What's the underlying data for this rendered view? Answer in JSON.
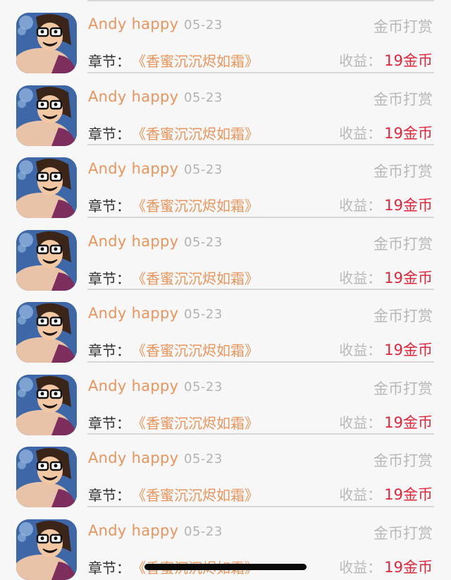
{
  "list": {
    "items": [
      {
        "name": "Andy happy",
        "date": "05-23",
        "type": "金币打赏",
        "chapter_label": "章节：",
        "chapter_name": "《香蜜沉沉烬如霜》",
        "earn_label": "收益：",
        "earn_value": "19金币"
      },
      {
        "name": "Andy happy",
        "date": "05-23",
        "type": "金币打赏",
        "chapter_label": "章节：",
        "chapter_name": "《香蜜沉沉烬如霜》",
        "earn_label": "收益：",
        "earn_value": "19金币"
      },
      {
        "name": "Andy happy",
        "date": "05-23",
        "type": "金币打赏",
        "chapter_label": "章节：",
        "chapter_name": "《香蜜沉沉烬如霜》",
        "earn_label": "收益：",
        "earn_value": "19金币"
      },
      {
        "name": "Andy happy",
        "date": "05-23",
        "type": "金币打赏",
        "chapter_label": "章节：",
        "chapter_name": "《香蜜沉沉烬如霜》",
        "earn_label": "收益：",
        "earn_value": "19金币"
      },
      {
        "name": "Andy happy",
        "date": "05-23",
        "type": "金币打赏",
        "chapter_label": "章节：",
        "chapter_name": "《香蜜沉沉烬如霜》",
        "earn_label": "收益：",
        "earn_value": "19金币"
      },
      {
        "name": "Andy happy",
        "date": "05-23",
        "type": "金币打赏",
        "chapter_label": "章节：",
        "chapter_name": "《香蜜沉沉烬如霜》",
        "earn_label": "收益：",
        "earn_value": "19金币"
      },
      {
        "name": "Andy happy",
        "date": "05-23",
        "type": "金币打赏",
        "chapter_label": "章节：",
        "chapter_name": "《香蜜沉沉烬如霜》",
        "earn_label": "收益：",
        "earn_value": "19金币"
      },
      {
        "name": "Andy happy",
        "date": "05-23",
        "type": "金币打赏",
        "chapter_label": "章节：",
        "chapter_name": "《香蜜沉沉烬如霜》",
        "earn_label": "收益：",
        "earn_value": "19金币"
      }
    ]
  },
  "colors": {
    "name": "#e9955c",
    "chapter_name": "#e9955c",
    "earn_value": "#e1253a",
    "muted": "#b8b8b8",
    "background": "#f7f7f7"
  },
  "icons": {
    "avatar": "cartoon-character-avatar-icon"
  }
}
